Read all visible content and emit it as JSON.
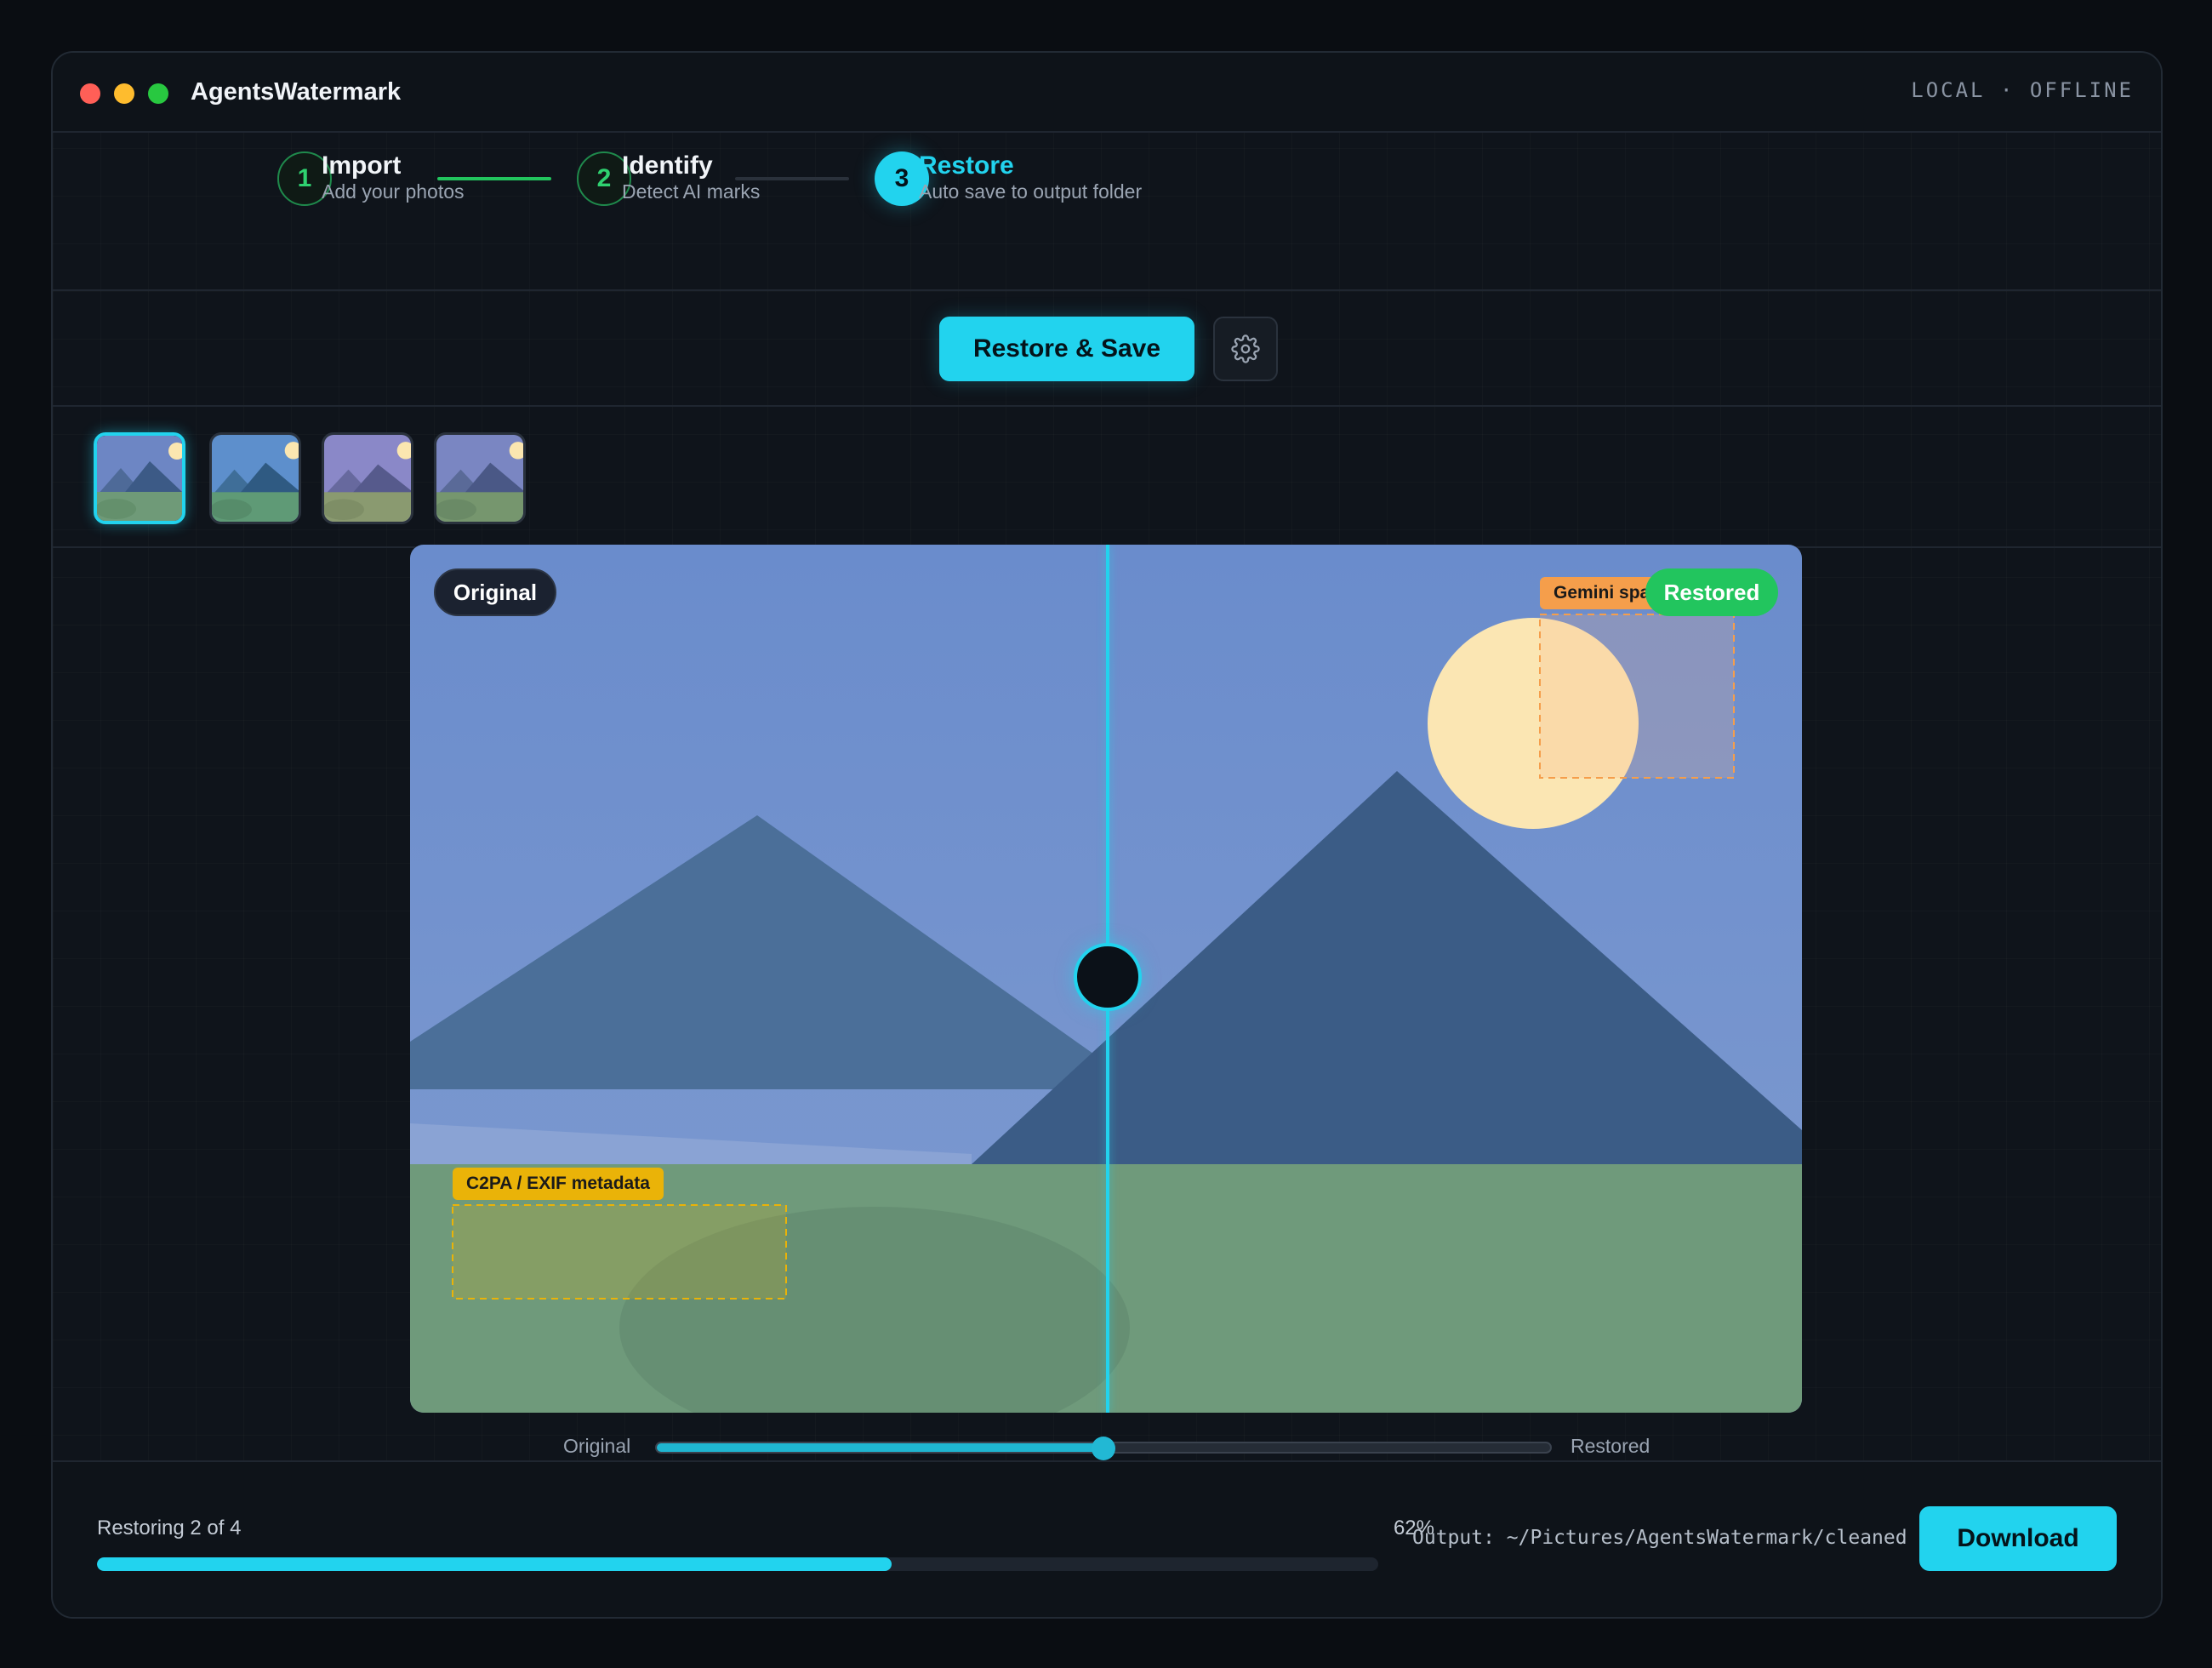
{
  "app": {
    "title": "AgentsWatermark",
    "status": "LOCAL · OFFLINE"
  },
  "steps": [
    {
      "number": "1",
      "title": "Import",
      "subtitle": "Add your photos",
      "state": "done"
    },
    {
      "number": "2",
      "title": "Identify",
      "subtitle": "Detect AI marks",
      "state": "done"
    },
    {
      "number": "3",
      "title": "Restore",
      "subtitle": "Auto save to output folder",
      "state": "active"
    }
  ],
  "toolbar": {
    "restore_save_label": "Restore & Save",
    "settings_icon": "gear-icon"
  },
  "thumbnails": {
    "count": 4,
    "selected_index": 0
  },
  "viewer": {
    "original_label": "Original",
    "restored_label": "Restored",
    "detections": [
      {
        "label": "Gemini sparkle",
        "color": "#f59e4b"
      },
      {
        "label": "C2PA / EXIF metadata",
        "color": "#eab308"
      }
    ]
  },
  "compare": {
    "left_label": "Original",
    "right_label": "Restored",
    "position": 0.5
  },
  "progress": {
    "label": "Restoring 2 of 4",
    "percent_text": "62%",
    "value": 0.62
  },
  "output": {
    "path_text": "Output: ~/Pictures/AgentsWatermark/cleaned"
  },
  "footer": {
    "download_label": "Download"
  },
  "colors": {
    "accent": "#22d3ee",
    "success": "#22c55e",
    "warning": "#eab308",
    "orange": "#f59e4b"
  }
}
